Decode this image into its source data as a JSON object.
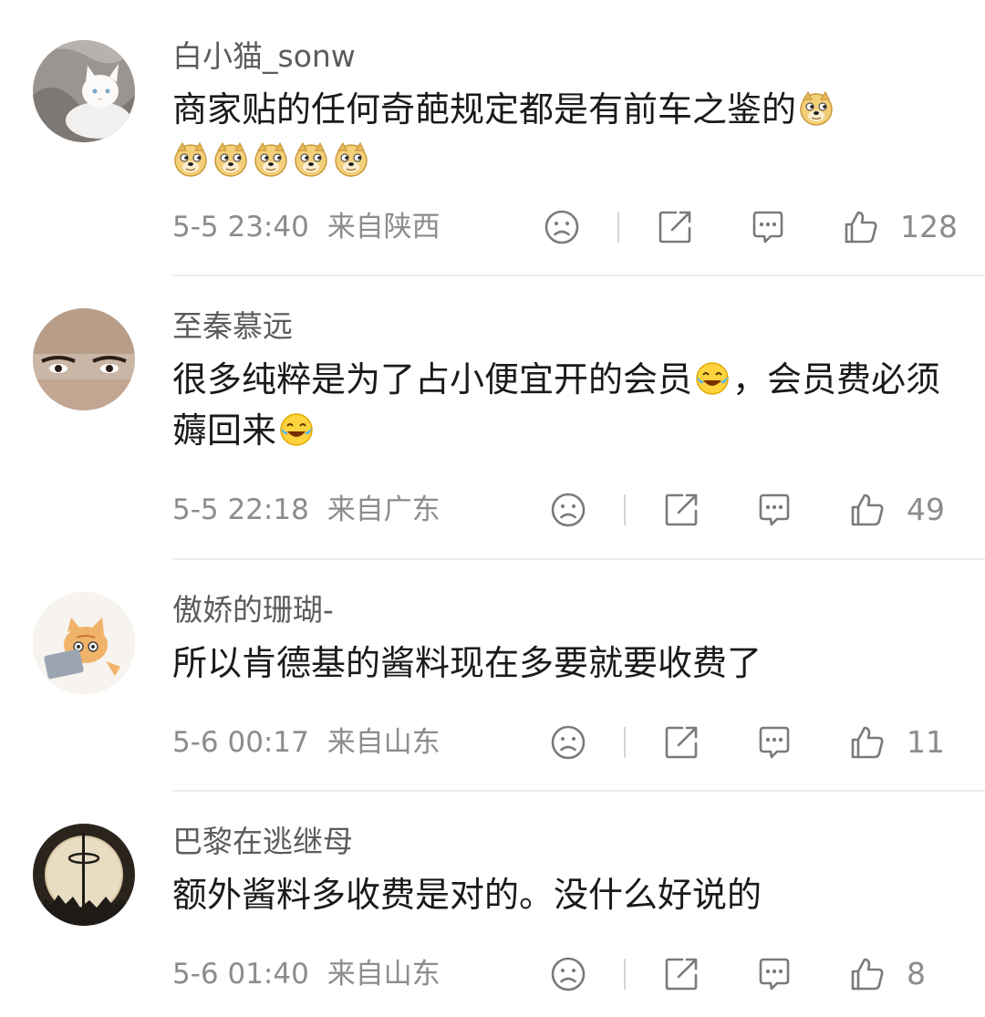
{
  "comments": [
    {
      "username": "白小猫_sonw",
      "text": "商家贴的任何奇葩规定都是有前车之鉴的",
      "emoji_trailing": [
        "doge-emoji",
        "doge-emoji",
        "doge-emoji",
        "doge-emoji",
        "doge-emoji",
        "doge-emoji"
      ],
      "time": "5-5 23:40",
      "location": "来自陕西",
      "likes": "128"
    },
    {
      "username": "至秦慕远",
      "text_a": "很多纯粹是为了占小便宜开的会员",
      "text_b": "，会员费必须薅回来",
      "emoji": "laugh-cry-emoji",
      "time": "5-5 22:18",
      "location": "来自广东",
      "likes": "49"
    },
    {
      "username": "傲娇的珊瑚-",
      "text": "所以肯德基的酱料现在多要就要收费了",
      "time": "5-6 00:17",
      "location": "来自山东",
      "likes": "11"
    },
    {
      "username": "巴黎在逃继母",
      "text": "额外酱料多收费是对的。没什么好说的",
      "time": "5-6 01:40",
      "location": "来自山东",
      "likes": "8"
    }
  ],
  "icons": {
    "dislike": "frown-face-icon",
    "share": "share-icon",
    "reply": "comment-bubble-icon",
    "like": "thumbs-up-icon"
  },
  "colors": {
    "username": "#5c5c5c",
    "meta": "#8c8c8c",
    "divider": "#ececec"
  }
}
